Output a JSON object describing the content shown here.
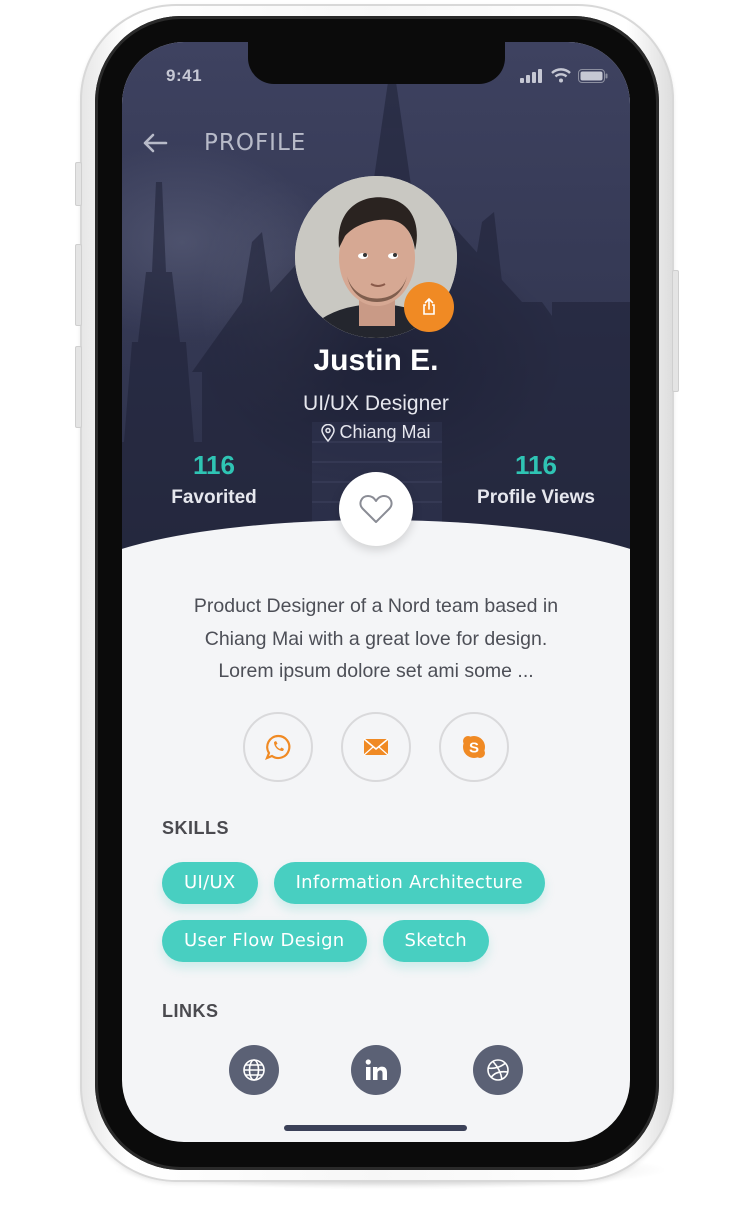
{
  "status_bar": {
    "time": "9:41"
  },
  "nav": {
    "title": "PROFILE",
    "back_icon": "arrow-left-icon"
  },
  "profile": {
    "name": "Justin E.",
    "role": "UI/UX Designer",
    "location": "Chiang Mai",
    "share_icon": "share-icon"
  },
  "stats": [
    {
      "value": "116",
      "label": "Favorited"
    },
    {
      "value": "116",
      "label": "Profile Views"
    }
  ],
  "favorite": {
    "icon": "heart-icon"
  },
  "bio": {
    "lines": [
      "Product Designer of a Nord team based in",
      "Chiang Mai with a great love for design.",
      "Lorem ipsum dolore set ami some ..."
    ]
  },
  "contacts": [
    {
      "name": "whatsapp",
      "icon": "whatsapp-icon"
    },
    {
      "name": "email",
      "icon": "mail-icon"
    },
    {
      "name": "skype",
      "icon": "skype-icon"
    }
  ],
  "skills": {
    "title": "SKILLS",
    "items": [
      "UI/UX",
      "Information Architecture",
      "User Flow Design",
      "Sketch"
    ]
  },
  "links": {
    "title": "LINKS",
    "items": [
      {
        "name": "website",
        "icon": "globe-icon"
      },
      {
        "name": "linkedin",
        "icon": "linkedin-icon"
      },
      {
        "name": "dribbble",
        "icon": "dribbble-icon"
      }
    ]
  },
  "colors": {
    "accent_teal": "#48cfc1",
    "stat_teal": "#2fc4b4",
    "accent_orange": "#f08a24",
    "hero_dark": "#363a56",
    "link_gray": "#5b6175"
  }
}
